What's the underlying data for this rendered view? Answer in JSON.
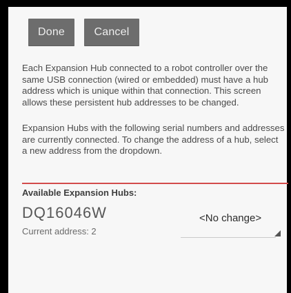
{
  "toolbar": {
    "done_label": "Done",
    "cancel_label": "Cancel"
  },
  "description": {
    "paragraph_1": "Each Expansion Hub connected to a robot controller over the same USB connection (wired or embedded) must have a hub address which is unique within that connection. This screen allows these persistent hub addresses to be changed.",
    "paragraph_2": "Expansion Hubs with the following serial numbers and addresses are currently connected. To change the address of a hub, select a new address from the dropdown."
  },
  "hubs_section": {
    "title": "Available Expansion Hubs:",
    "items": [
      {
        "serial": "DQ16046W",
        "current_address": "Current address: 2",
        "selected_option": "<No change>"
      }
    ]
  },
  "colors": {
    "button_bg": "#6d6d6d",
    "divider": "#d24b4b",
    "background": "#f7f7f7"
  }
}
